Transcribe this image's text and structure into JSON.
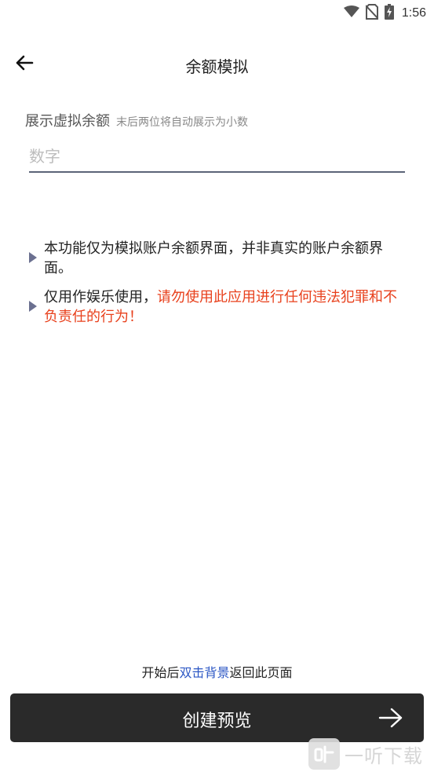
{
  "status_bar": {
    "time": "1:56",
    "icons": [
      "wifi-icon",
      "no-sim-icon",
      "battery-charging-icon"
    ]
  },
  "app_bar": {
    "title": "余额模拟",
    "back_icon": "arrow-left-icon"
  },
  "form": {
    "label": "展示虚拟余额",
    "hint": "末后两位将自动展示为小数",
    "input_value": "",
    "input_placeholder": "数字"
  },
  "notices": [
    {
      "text": "本功能仅为模拟账户余额界面，并非真实的账户余额界面。"
    },
    {
      "text": "仅用作娱乐使用，",
      "warning": "请勿使用此应用进行任何违法犯罪和不负责任的行为！"
    }
  ],
  "bottom_hint": {
    "prefix": "开始后",
    "highlight": "双击背景",
    "suffix": "返回此页面"
  },
  "create_button": {
    "label": "创建预览",
    "icon": "arrow-right-icon"
  },
  "watermark": {
    "text": "一听下载"
  },
  "colors": {
    "warning": "#e8401c",
    "link": "#2b56c4",
    "button_bg": "#2a2a2a",
    "bullet": "#6b7090",
    "input_underline": "#5c6478"
  }
}
